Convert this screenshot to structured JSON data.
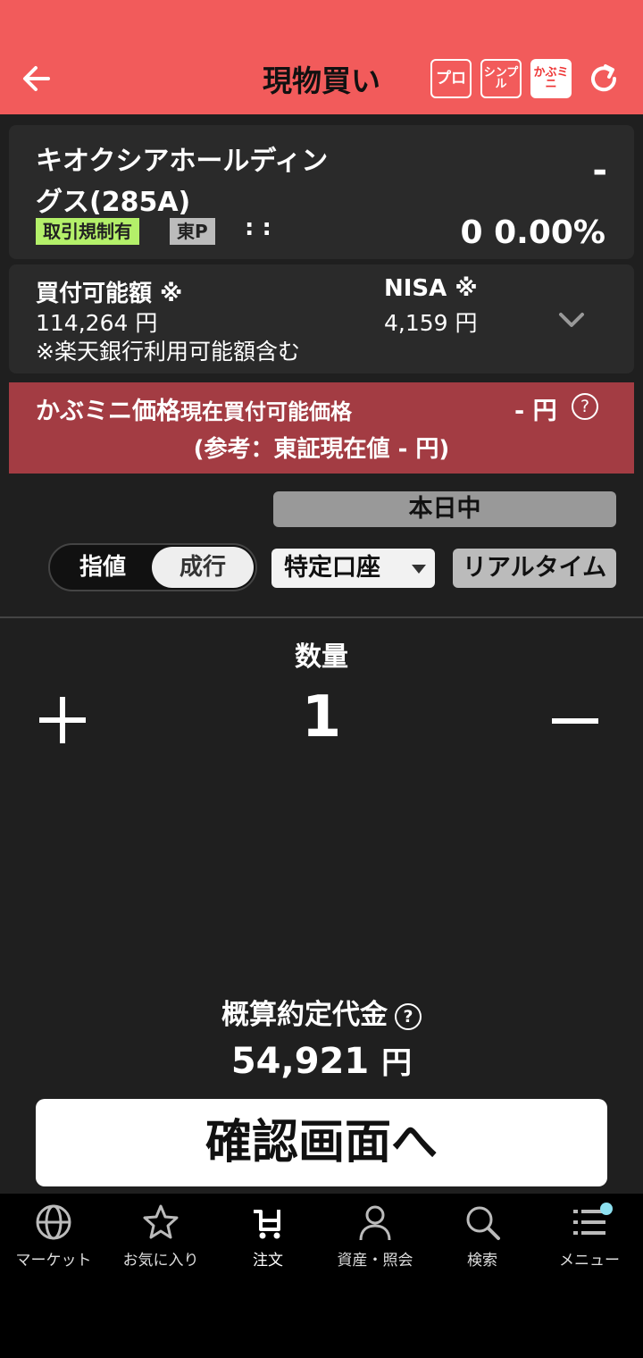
{
  "header": {
    "title": "現物買い",
    "buttons": {
      "pro": "プロ",
      "simple": "シンプル",
      "kabumini": "かぶミニ"
    }
  },
  "stock": {
    "name": "キオクシアホールディングス(285A)",
    "change_dash": "-",
    "tags": {
      "restricted": "取引規制有",
      "market": "東P"
    },
    "time": ": :",
    "price_change": "0  0.00%"
  },
  "funds": {
    "buying_power_label": "買付可能額 ※",
    "buying_power_value": "114,264 円",
    "nisa_label": "NISA ※",
    "nisa_value": "4,159 円",
    "note": "※楽天銀行利用可能額含む"
  },
  "kabumini_price": {
    "label": "かぶミニ価格",
    "sublabel": "現在買付可能価格",
    "value": "- 円",
    "help": "?",
    "reference": "(参考：東証現在値 - 円)"
  },
  "period": "本日中",
  "order_type": {
    "limit": "指値",
    "market": "成行",
    "selected": "成行"
  },
  "account": "特定口座",
  "realtime": "リアルタイム",
  "quantity": {
    "label": "数量",
    "value": "1"
  },
  "estimate": {
    "label": "概算約定代金",
    "help": "?",
    "value": "54,921",
    "unit": "円"
  },
  "confirm_button": "確認画面へ",
  "nav": {
    "market": "マーケット",
    "favorites": "お気に入り",
    "order": "注文",
    "assets": "資産・照会",
    "search": "検索",
    "menu": "メニュー"
  },
  "colors": {
    "header": "#f25b5b",
    "banner": "#a33c43",
    "tag_green": "#b4f06a",
    "menu_dot": "#8de0f0"
  }
}
